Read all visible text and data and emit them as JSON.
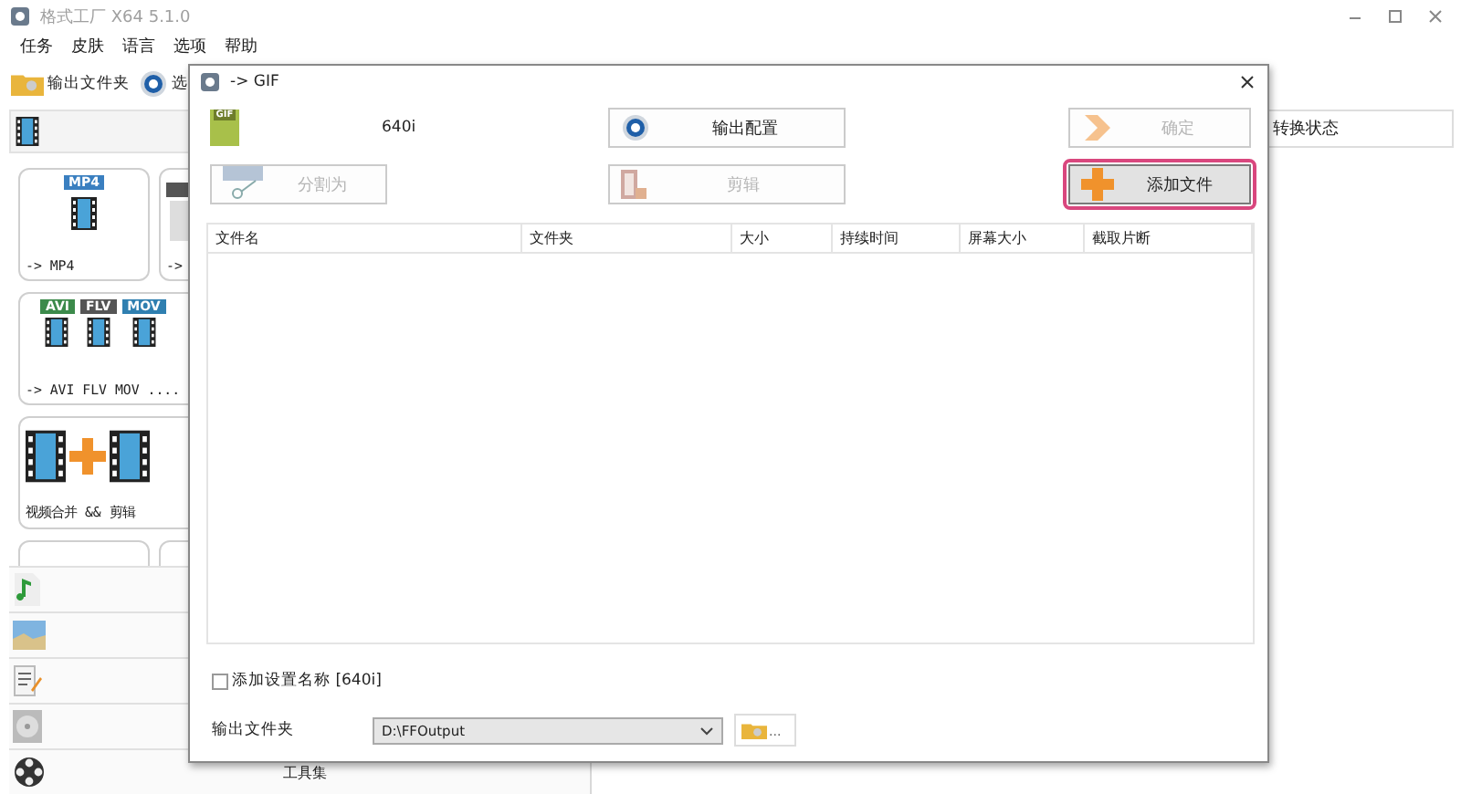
{
  "window": {
    "title": "格式工厂 X64 5.1.0"
  },
  "menu": [
    "任务",
    "皮肤",
    "语言",
    "选项",
    "帮助"
  ],
  "toolbar": [
    {
      "kind": "folder",
      "label": "输出文件夹"
    },
    {
      "kind": "options",
      "label": "选"
    }
  ],
  "tiles": [
    {
      "kind": "mp4",
      "label": "-> MP4",
      "badges": [
        "MP4"
      ]
    },
    {
      "kind": "partial",
      "label": "->"
    },
    {
      "kind": "formats",
      "label": "-> AVI FLV MOV ....",
      "badges": [
        "AVI",
        "FLV",
        "MOV"
      ]
    },
    {
      "kind": "merge",
      "label": "视频合并 && 剪辑"
    }
  ],
  "categories": [
    {
      "kind": "audio"
    },
    {
      "kind": "picture"
    },
    {
      "kind": "document"
    },
    {
      "kind": "disc"
    },
    {
      "kind": "tools",
      "label": "工具集"
    }
  ],
  "task_table": {
    "columns": [
      "转换状态"
    ]
  },
  "dialog": {
    "title": "-> GIF",
    "format_badge": "GIF",
    "preset": "640i",
    "buttons": [
      {
        "kind": "settings",
        "label": "输出配置",
        "disabled": false,
        "highlighted": false
      },
      {
        "kind": "ok",
        "label": "确定",
        "disabled": true,
        "highlighted": false
      },
      {
        "kind": "split",
        "label": "分割为",
        "disabled": true,
        "highlighted": false
      },
      {
        "kind": "clip",
        "label": "剪辑",
        "disabled": true,
        "highlighted": false
      },
      {
        "kind": "add",
        "label": "添加文件",
        "disabled": false,
        "highlighted": true
      }
    ],
    "columns": [
      "文件名",
      "文件夹",
      "大小",
      "持续时间",
      "屏幕大小",
      "截取片断"
    ],
    "append_name": {
      "label": "添加设置名称 [640i]",
      "checked": false
    },
    "output_folder": {
      "label": "输出文件夹",
      "value": "D:\\FFOutput",
      "browse": "..."
    }
  }
}
